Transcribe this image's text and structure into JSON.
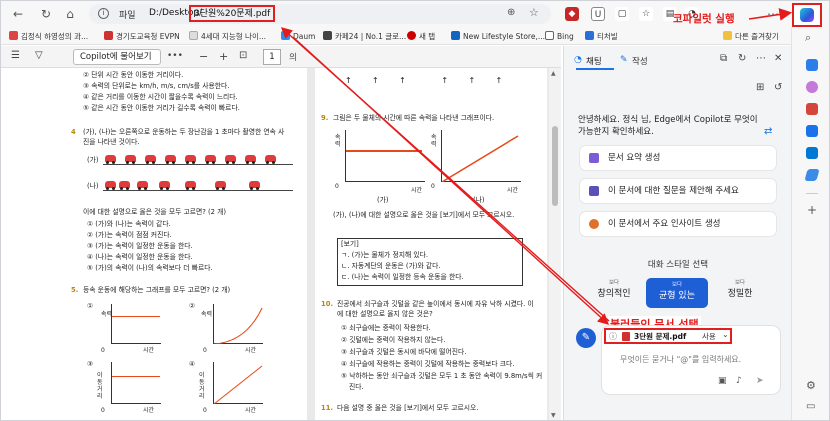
{
  "browser": {
    "url_label": "파일",
    "url_path": "D:/Desktop/",
    "url_file": "3단원%20문제.pdf",
    "bookmarks": [
      "김정식 하영성의 과...",
      "경기도교육청 EVPN",
      "4세대 지능형 나이...",
      "Daum",
      "카페24 | No.1 글로...",
      "새 탭",
      "New Lifestyle Store,...",
      "Bing",
      "티처빌"
    ],
    "other_favorites": "다른 즐겨찾기"
  },
  "pdf_toolbar": {
    "ask_copilot": "Copilot에 물어보기",
    "more": "•••",
    "page_number": "1",
    "page_suffix": "의"
  },
  "doc_left": {
    "lines_top": [
      "② 단위 시간 동안 이동한 거리이다.",
      "③ 속력의 단위로는 km/h, m/s, cm/s를 사용한다.",
      "④ 같은 거리를 이동한 시간이 짧을수록 속력이 느리다.",
      "⑤ 같은 시간 동안 이동한 거리가 길수록 속력이 빠르다."
    ],
    "q4_number": "4",
    "q4_text": "(가), (나)는 오른쪽으로 운동하는 두 장난감을 1 초마다 촬영한 연속 사",
    "q4_text2": "진을 나타낸 것이다.",
    "row_a": "(가)",
    "row_b": "(나)",
    "q4_ask": "이에 대한 설명으로 옳은 것을 모두 고르면? (2 개)",
    "q4_options": [
      "① (가)와 (나)는 속력이 같다.",
      "② (가)는 속력이 점점 커진다.",
      "③ (가)는 속력이 일정한 운동을 한다.",
      "④ (나)는 속력이 일정한 운동을 한다.",
      "⑤ (가)의 속력이 (나)의 속력보다 더 빠르다."
    ],
    "q5_number": "5.",
    "q5_text": "등속 운동에 해당하는 그래프를 모두 고르면? (2 개)",
    "graph_labels": [
      "①",
      "②",
      "③",
      "④"
    ],
    "axis_speed": "속력",
    "axis_distance": "이동거리",
    "axis_time": "시간",
    "origin": "0"
  },
  "doc_right": {
    "q9_number": "9.",
    "q9_text": "그림은 두 물체의 시간에 따른 속력을 나타낸 그래프이다.",
    "graph_a_label": "(가)",
    "graph_b_label": "(나)",
    "axis_speed": "속력",
    "axis_time": "시간",
    "origin": "0",
    "q9_ask": "(가), (나)에 대한 설명으로 옳은 것을 [보기]에서 모두 고르시오.",
    "box_title": "[보기]",
    "box_lines": [
      "ㄱ. (가)는 물체가 정지해 있다.",
      "ㄴ. 자동계단의 운동은 (가)와 같다.",
      "ㄷ. (나)는 속력이 일정한 등속 운동을 한다."
    ],
    "q10_number": "10.",
    "q10_text": "진공에서 쇠구슬과 깃털을 같은 높이에서 동시에 자유 낙하 시켰다. 이",
    "q10_text2": "에 대한 설명으로 옳지 않은 것은?",
    "q10_options": [
      "① 쇠구슬에는 중력이 작용한다.",
      "② 깃털에는 중력이 작용하지 않는다.",
      "③ 쇠구슬과 깃털은 동시에 바닥에 떨어진다.",
      "④ 쇠구슬에 작용하는 중력이 깃털에 작용하는 중력보다 크다.",
      "⑤ 낙하하는 동안 쇠구슬과 깃털은 모두 1 초 동안 속력이 9.8m/s씩 커",
      "진다."
    ],
    "q11_number": "11.",
    "q11_text": "다음 설명 중 옳은 것을 [보기]에서 모두 고르시오."
  },
  "copilot": {
    "tab_chat": "채팅",
    "tab_compose": "작성",
    "greeting": "안녕하세요. 정식 님, Edge에서 Copilot로 무엇이 가능한지 확인하세요.",
    "suggestions": [
      "문서 요약 생성",
      "이 문서에 대한 질문을 제안해 주세요",
      "이 문서에서 주요 인사이트 생성"
    ],
    "style_title": "대화 스타일 선택",
    "styles": [
      {
        "small": "보다",
        "label": "창의적인"
      },
      {
        "small": "보다",
        "label": "균형 있는"
      },
      {
        "small": "보다",
        "label": "정밀한"
      }
    ],
    "doc_chip_file": "3단원 문제.pdf",
    "doc_chip_suffix": "사용",
    "input_placeholder": "무엇이든 묻거나 \"@\"를 입력하세요."
  },
  "annotations": {
    "copilot_run": "코파일럿 실행",
    "select_doc": "불러들인 문서 선택"
  },
  "colors": {
    "annotation_red": "#e41b1b",
    "accent_blue": "#1a73e8",
    "balanced_blue": "#1f5fd6"
  }
}
